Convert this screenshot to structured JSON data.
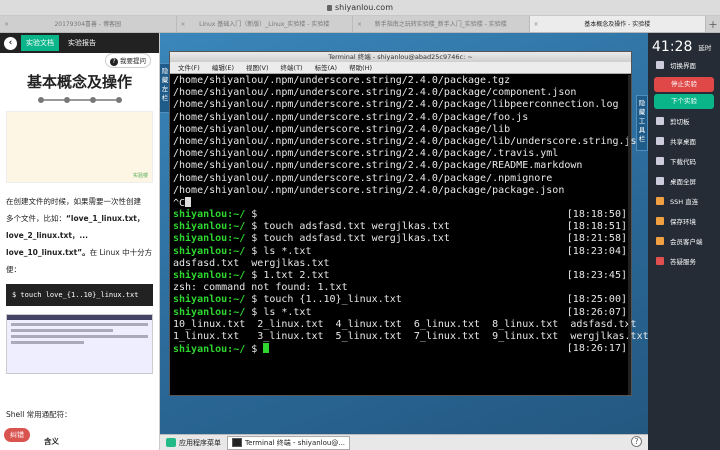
{
  "browser": {
    "url": "shiyanlou.com"
  },
  "tabs": [
    "20179304喜善 - 博客园",
    "Linux 基础入门（新版）_Linux_实验楼 - 实验楼",
    "新手指南之玩转实验楼_新手入门_实验楼 - 实验楼",
    "基本概念及操作 - 实验楼"
  ],
  "left": {
    "nav": {
      "doc": "实验文档",
      "report": "实验报告"
    },
    "feedback": "我要提问",
    "title": "基本概念及操作",
    "img_logo": "实验楼",
    "para": [
      "在创建文件的时候，如果需要一次性创建",
      "多个文件，比如：",
      "“love_1_linux.txt，",
      "love_2_linux.txt，...",
      "love_10_linux.txt”。",
      "在 Linux 中十分方",
      "便："
    ],
    "code": "$ touch love_{1..10}_linux.txt",
    "shell": "Shell 常用通配符：",
    "jc": "纠错",
    "meaning": "含义"
  },
  "desktop": {
    "side_left": "隐藏左栏",
    "side_right": "隐藏工具栏",
    "terminal": {
      "title": "Terminal 终端 - shiyanlou@abad25c9746c: ~",
      "menu": [
        "文件(F)",
        "编辑(E)",
        "视图(V)",
        "终端(T)",
        "标签(A)",
        "帮助(H)"
      ],
      "lines": [
        {
          "t": "/home/shiyanlou/.npm/underscore.string/2.4.0/package.tgz"
        },
        {
          "t": "/home/shiyanlou/.npm/underscore.string/2.4.0/package/component.json"
        },
        {
          "t": "/home/shiyanlou/.npm/underscore.string/2.4.0/package/libpeerconnection.log"
        },
        {
          "t": "/home/shiyanlou/.npm/underscore.string/2.4.0/package/foo.js"
        },
        {
          "t": "/home/shiyanlou/.npm/underscore.string/2.4.0/package/lib"
        },
        {
          "t": "/home/shiyanlou/.npm/underscore.string/2.4.0/package/lib/underscore.string.js"
        },
        {
          "t": "/home/shiyanlou/.npm/underscore.string/2.4.0/package/.travis.yml"
        },
        {
          "t": "/home/shiyanlou/.npm/underscore.string/2.4.0/package/README.markdown"
        },
        {
          "t": "/home/shiyanlou/.npm/underscore.string/2.4.0/package/.npmignore"
        },
        {
          "t": "/home/shiyanlou/.npm/underscore.string/2.4.0/package/package.json"
        },
        {
          "t": "^C"
        },
        {
          "p": "shiyanlou:~/ $ ",
          "c": "",
          "ts": "[18:18:50]"
        },
        {
          "p": "shiyanlou:~/ $ ",
          "c": "touch adsfasd.txt wergjlkas.txt",
          "ts": "[18:18:51]"
        },
        {
          "p": "shiyanlou:~/ $ ",
          "c": "touch adsfasd.txt wergjlkas.txt",
          "ts": "[18:21:58]"
        },
        {
          "p": "shiyanlou:~/ $ ",
          "c": "ls *.txt",
          "ts": "[18:23:04]"
        },
        {
          "t": "adsfasd.txt  wergjlkas.txt"
        },
        {
          "p": "shiyanlou:~/ $ ",
          "c": "1.txt 2.txt",
          "ts": "[18:23:45]"
        },
        {
          "t": "zsh: command not found: 1.txt"
        },
        {
          "p": "shiyanlou:~/ $ ",
          "c": "touch {1..10}_linux.txt",
          "ts": "[18:25:00]"
        },
        {
          "p": "shiyanlou:~/ $ ",
          "c": "ls *.txt",
          "ts": "[18:26:07]"
        },
        {
          "t": "10_linux.txt  2_linux.txt  4_linux.txt  6_linux.txt  8_linux.txt  adsfasd.txt"
        },
        {
          "t": "1_linux.txt   3_linux.txt  5_linux.txt  7_linux.txt  9_linux.txt  wergjlkas.txt"
        },
        {
          "p": "shiyanlou:~/ $ ",
          "c": "",
          "ts": "[18:26:17]",
          "cursor": true
        }
      ]
    },
    "taskbar": {
      "apps": "应用程序菜单",
      "term": "Terminal 终端 - shiyanlou@..."
    }
  },
  "right": {
    "timer": "41:28",
    "timer_label": "延时",
    "items": [
      {
        "label": "切换界面",
        "kind": "item"
      },
      {
        "label": "停止实验",
        "kind": "red"
      },
      {
        "label": "下个实验",
        "kind": "green"
      },
      {
        "label": "剪切板",
        "kind": "item"
      },
      {
        "label": "共享桌面",
        "kind": "item"
      },
      {
        "label": "下载代码",
        "kind": "item"
      },
      {
        "label": "桌面全屏",
        "kind": "item"
      },
      {
        "label": "SSH 直连",
        "kind": "o"
      },
      {
        "label": "保存环境",
        "kind": "o"
      },
      {
        "label": "会员客户端",
        "kind": "o"
      },
      {
        "label": "答疑服务",
        "kind": "r"
      }
    ]
  }
}
